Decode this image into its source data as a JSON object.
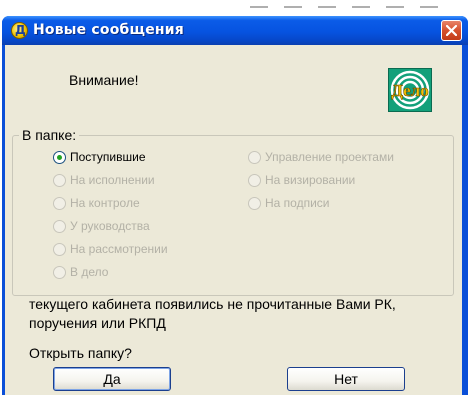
{
  "window": {
    "title": "Новые сообщения",
    "title_icon_glyph": "Д",
    "icons": {
      "title": "app-icon",
      "close": "close-icon"
    }
  },
  "header": {
    "warning": "Внимание!",
    "logo_text": "Дело"
  },
  "folder_group": {
    "legend": "В папке:",
    "options": [
      {
        "label": "Поступившие",
        "selected": true,
        "enabled": true
      },
      {
        "label": "На исполнении",
        "selected": false,
        "enabled": false
      },
      {
        "label": "На контроле",
        "selected": false,
        "enabled": false
      },
      {
        "label": "У руководства",
        "selected": false,
        "enabled": false
      },
      {
        "label": "На рассмотрении",
        "selected": false,
        "enabled": false
      },
      {
        "label": "В дело",
        "selected": false,
        "enabled": false
      },
      {
        "label": "Управление проектами",
        "selected": false,
        "enabled": false
      },
      {
        "label": "На визировании",
        "selected": false,
        "enabled": false
      },
      {
        "label": "На подписи",
        "selected": false,
        "enabled": false
      }
    ]
  },
  "message": "текущего кабинета появились не прочитанные Вами РК, поручения или РКПД",
  "question": "Открыть папку?",
  "buttons": {
    "yes": "Да",
    "no": "Нет"
  },
  "colors": {
    "title_bar": "#0653e0",
    "dialog_bg": "#ece9d8",
    "logo_bg": "#12a07a",
    "radio_dot": "#21a121"
  }
}
